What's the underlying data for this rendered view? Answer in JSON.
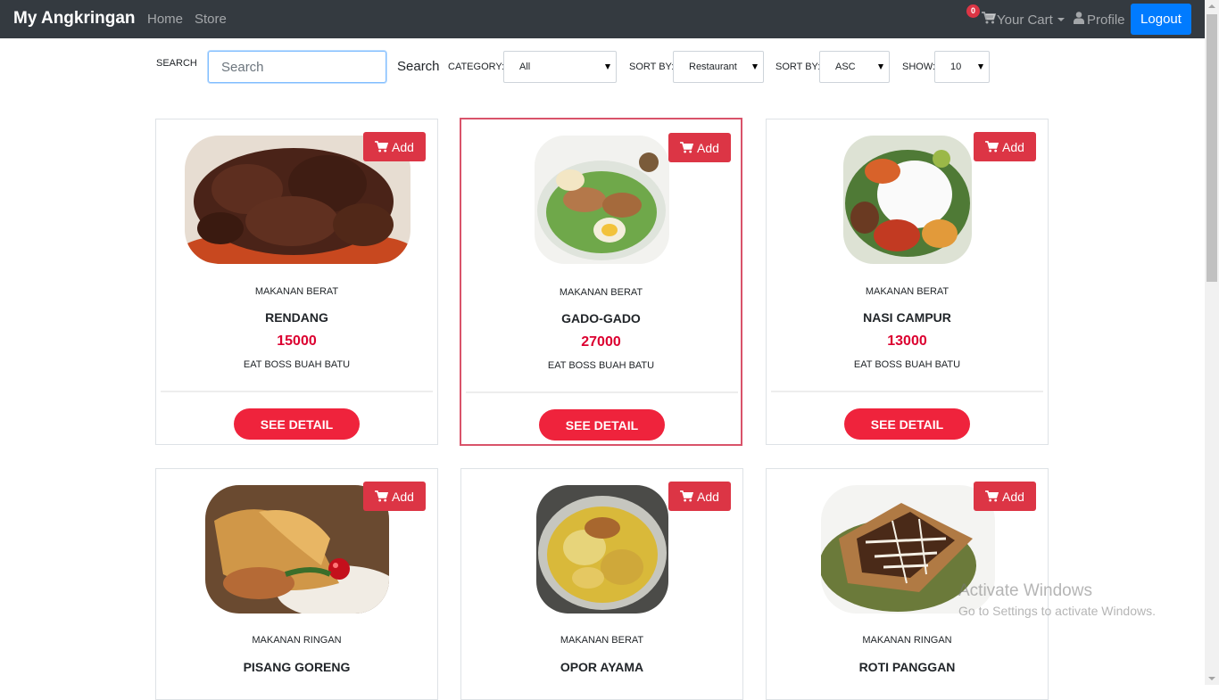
{
  "navbar": {
    "brand": "My Angkringan",
    "home": "Home",
    "store": "Store",
    "cart_label": "Your Cart",
    "cart_count": "0",
    "profile": "Profile",
    "logout": "Logout"
  },
  "filters": {
    "search_label": "SEARCH",
    "search_placeholder": "Search",
    "search_button": "Search",
    "category_label": "CATEGORY:",
    "category_value": "All",
    "sort_by_label": "SORT BY:",
    "sort_by_value": "Restaurant",
    "sort_order_label": "SORT BY:",
    "sort_order_value": "ASC",
    "show_label": "SHOW:",
    "show_value": "10"
  },
  "products": [
    {
      "category": "MAKANAN BERAT",
      "name": "RENDANG",
      "price": "15000",
      "restaurant": "EAT BOSS BUAH BATU",
      "add": "Add",
      "detail": "SEE DETAIL"
    },
    {
      "category": "MAKANAN BERAT",
      "name": "GADO-GADO",
      "price": "27000",
      "restaurant": "EAT BOSS BUAH BATU",
      "add": "Add",
      "detail": "SEE DETAIL"
    },
    {
      "category": "MAKANAN BERAT",
      "name": "NASI CAMPUR",
      "price": "13000",
      "restaurant": "EAT BOSS BUAH BATU",
      "add": "Add",
      "detail": "SEE DETAIL"
    },
    {
      "category": "MAKANAN RINGAN",
      "name": "PISANG GORENG",
      "add": "Add"
    },
    {
      "category": "MAKANAN BERAT",
      "name": "OPOR AYAMA",
      "add": "Add"
    },
    {
      "category": "MAKANAN RINGAN",
      "name": "ROTI PANGGAN",
      "add": "Add"
    }
  ],
  "watermark": {
    "title": "Activate Windows",
    "subtitle": "Go to Settings to activate Windows."
  },
  "colors": {
    "navbar": "#343a40",
    "logout": "#007bff",
    "add_button": "#dc3545",
    "detail_button": "#ef233c",
    "price": "#dc0030",
    "highlight_border": "#d9536a"
  },
  "icons": {
    "cart": "cart-icon",
    "profile": "user-icon"
  }
}
